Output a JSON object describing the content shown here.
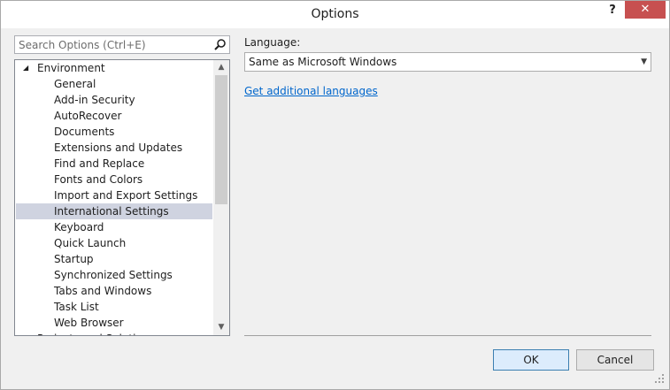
{
  "window": {
    "title": "Options",
    "help_label": "?",
    "close_label": "✕"
  },
  "search": {
    "placeholder": "Search Options (Ctrl+E)"
  },
  "tree": {
    "root": "Environment",
    "items": [
      "General",
      "Add-in Security",
      "AutoRecover",
      "Documents",
      "Extensions and Updates",
      "Find and Replace",
      "Fonts and Colors",
      "Import and Export Settings",
      "International Settings",
      "Keyboard",
      "Quick Launch",
      "Startup",
      "Synchronized Settings",
      "Tabs and Windows",
      "Task List",
      "Web Browser"
    ],
    "selected": "International Settings",
    "partial_next": "Projects and Solutions"
  },
  "main": {
    "language_label": "Language:",
    "language_value": "Same as Microsoft Windows",
    "link": "Get additional languages"
  },
  "buttons": {
    "ok": "OK",
    "cancel": "Cancel"
  },
  "icons": [
    "search-icon",
    "expand-triangle-icon",
    "scroll-up-icon",
    "scroll-down-icon",
    "dropdown-arrow-icon",
    "resize-grip-icon"
  ]
}
